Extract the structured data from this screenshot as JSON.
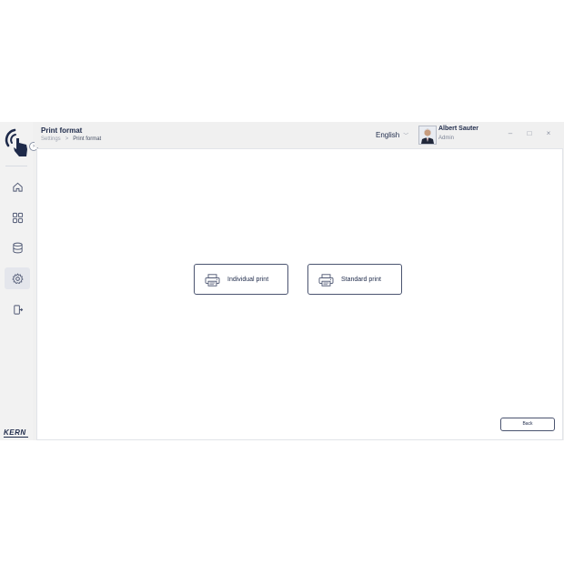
{
  "header": {
    "title": "Print format",
    "breadcrumb": [
      "Settings",
      "Print format"
    ],
    "language": "English",
    "user": {
      "name": "Albert Sauter",
      "role": "Admin"
    },
    "window_controls": {
      "minimize": "–",
      "maximize": "□",
      "close": "×"
    }
  },
  "sidebar": {
    "collapse_glyph": "›",
    "items": [
      {
        "icon": "home-icon"
      },
      {
        "icon": "apps-icon"
      },
      {
        "icon": "database-icon"
      },
      {
        "icon": "gear-icon",
        "active": true
      },
      {
        "icon": "logout-icon"
      }
    ],
    "brand": "KERN"
  },
  "main": {
    "options": [
      {
        "label": "Individual print",
        "icon": "printer-icon"
      },
      {
        "label": "Standard print",
        "icon": "printer-icon"
      }
    ],
    "back_label": "Back"
  },
  "colors": {
    "primary": "#1e2a4a",
    "active_nav": "#e4e6ec",
    "panel_bg": "#ffffff",
    "app_bg": "#f0f0f0"
  }
}
